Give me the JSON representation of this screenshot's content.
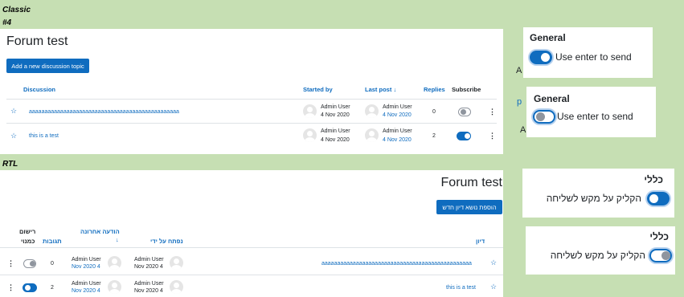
{
  "labels": {
    "classic": "Classic",
    "classic_num": "#4",
    "rtl": "RTL"
  },
  "classic": {
    "title": "Forum test",
    "add_button": "Add a new discussion topic",
    "headers": {
      "discussion": "Discussion",
      "started_by": "Started by",
      "last_post": "Last post",
      "last_post_arrow": "↓",
      "replies": "Replies",
      "subscribe": "Subscribe"
    },
    "rows": [
      {
        "topic": "aaaaaaaaaaaaaaaaaaaaaaaaaaaaaaaaaaaaaaaaaaaaaaaa",
        "started_name": "Admin User",
        "started_date": "4 Nov 2020",
        "last_name": "Admin User",
        "last_date": "4 Nov 2020",
        "replies": "0",
        "subscribed": false
      },
      {
        "topic": "this is a test",
        "started_name": "Admin User",
        "started_date": "4 Nov 2020",
        "last_name": "Admin User",
        "last_date": "4 Nov 2020",
        "replies": "2",
        "subscribed": true
      }
    ]
  },
  "rtl": {
    "title": "Forum test",
    "add_button": "הוספת נושא דיון חדש",
    "headers": {
      "discussion": "דיון",
      "started_by": "נפתח על ידי",
      "last_post": "הודעה אחרונה",
      "last_post_arrow": "↓",
      "replies": "תגובות",
      "subscribe_1": "רישום",
      "subscribe_2": "כמנוי"
    },
    "rows": [
      {
        "topic": "aaaaaaaaaaaaaaaaaaaaaaaaaaaaaaaaaaaaaaaaaaaaaaaa",
        "started_name": "Admin User",
        "started_date": "Nov 2020 4",
        "last_name": "Admin User",
        "last_date": "Nov 2020 4",
        "replies": "0",
        "subscribed": false
      },
      {
        "topic": "this is a test",
        "started_name": "Admin User",
        "started_date": "Nov 2020 4",
        "last_name": "Admin User",
        "last_date": "Nov 2020 4",
        "replies": "2",
        "subscribed": true
      }
    ]
  },
  "settings_ltr": [
    {
      "title": "General",
      "label": "Use enter to send",
      "on": true
    },
    {
      "title": "General",
      "label": "Use enter to send",
      "on": false
    }
  ],
  "settings_rtl": [
    {
      "title": "כללי",
      "label": "הקליק על מקש לשליחה",
      "on": true
    },
    {
      "title": "כללי",
      "label": "הקליק על מקש לשליחה",
      "on": false
    }
  ],
  "fragments": {
    "a1": "A",
    "a2": "A",
    "p": "p"
  },
  "colors": {
    "brand": "#0f6cbf",
    "background": "#c6dfb3"
  }
}
